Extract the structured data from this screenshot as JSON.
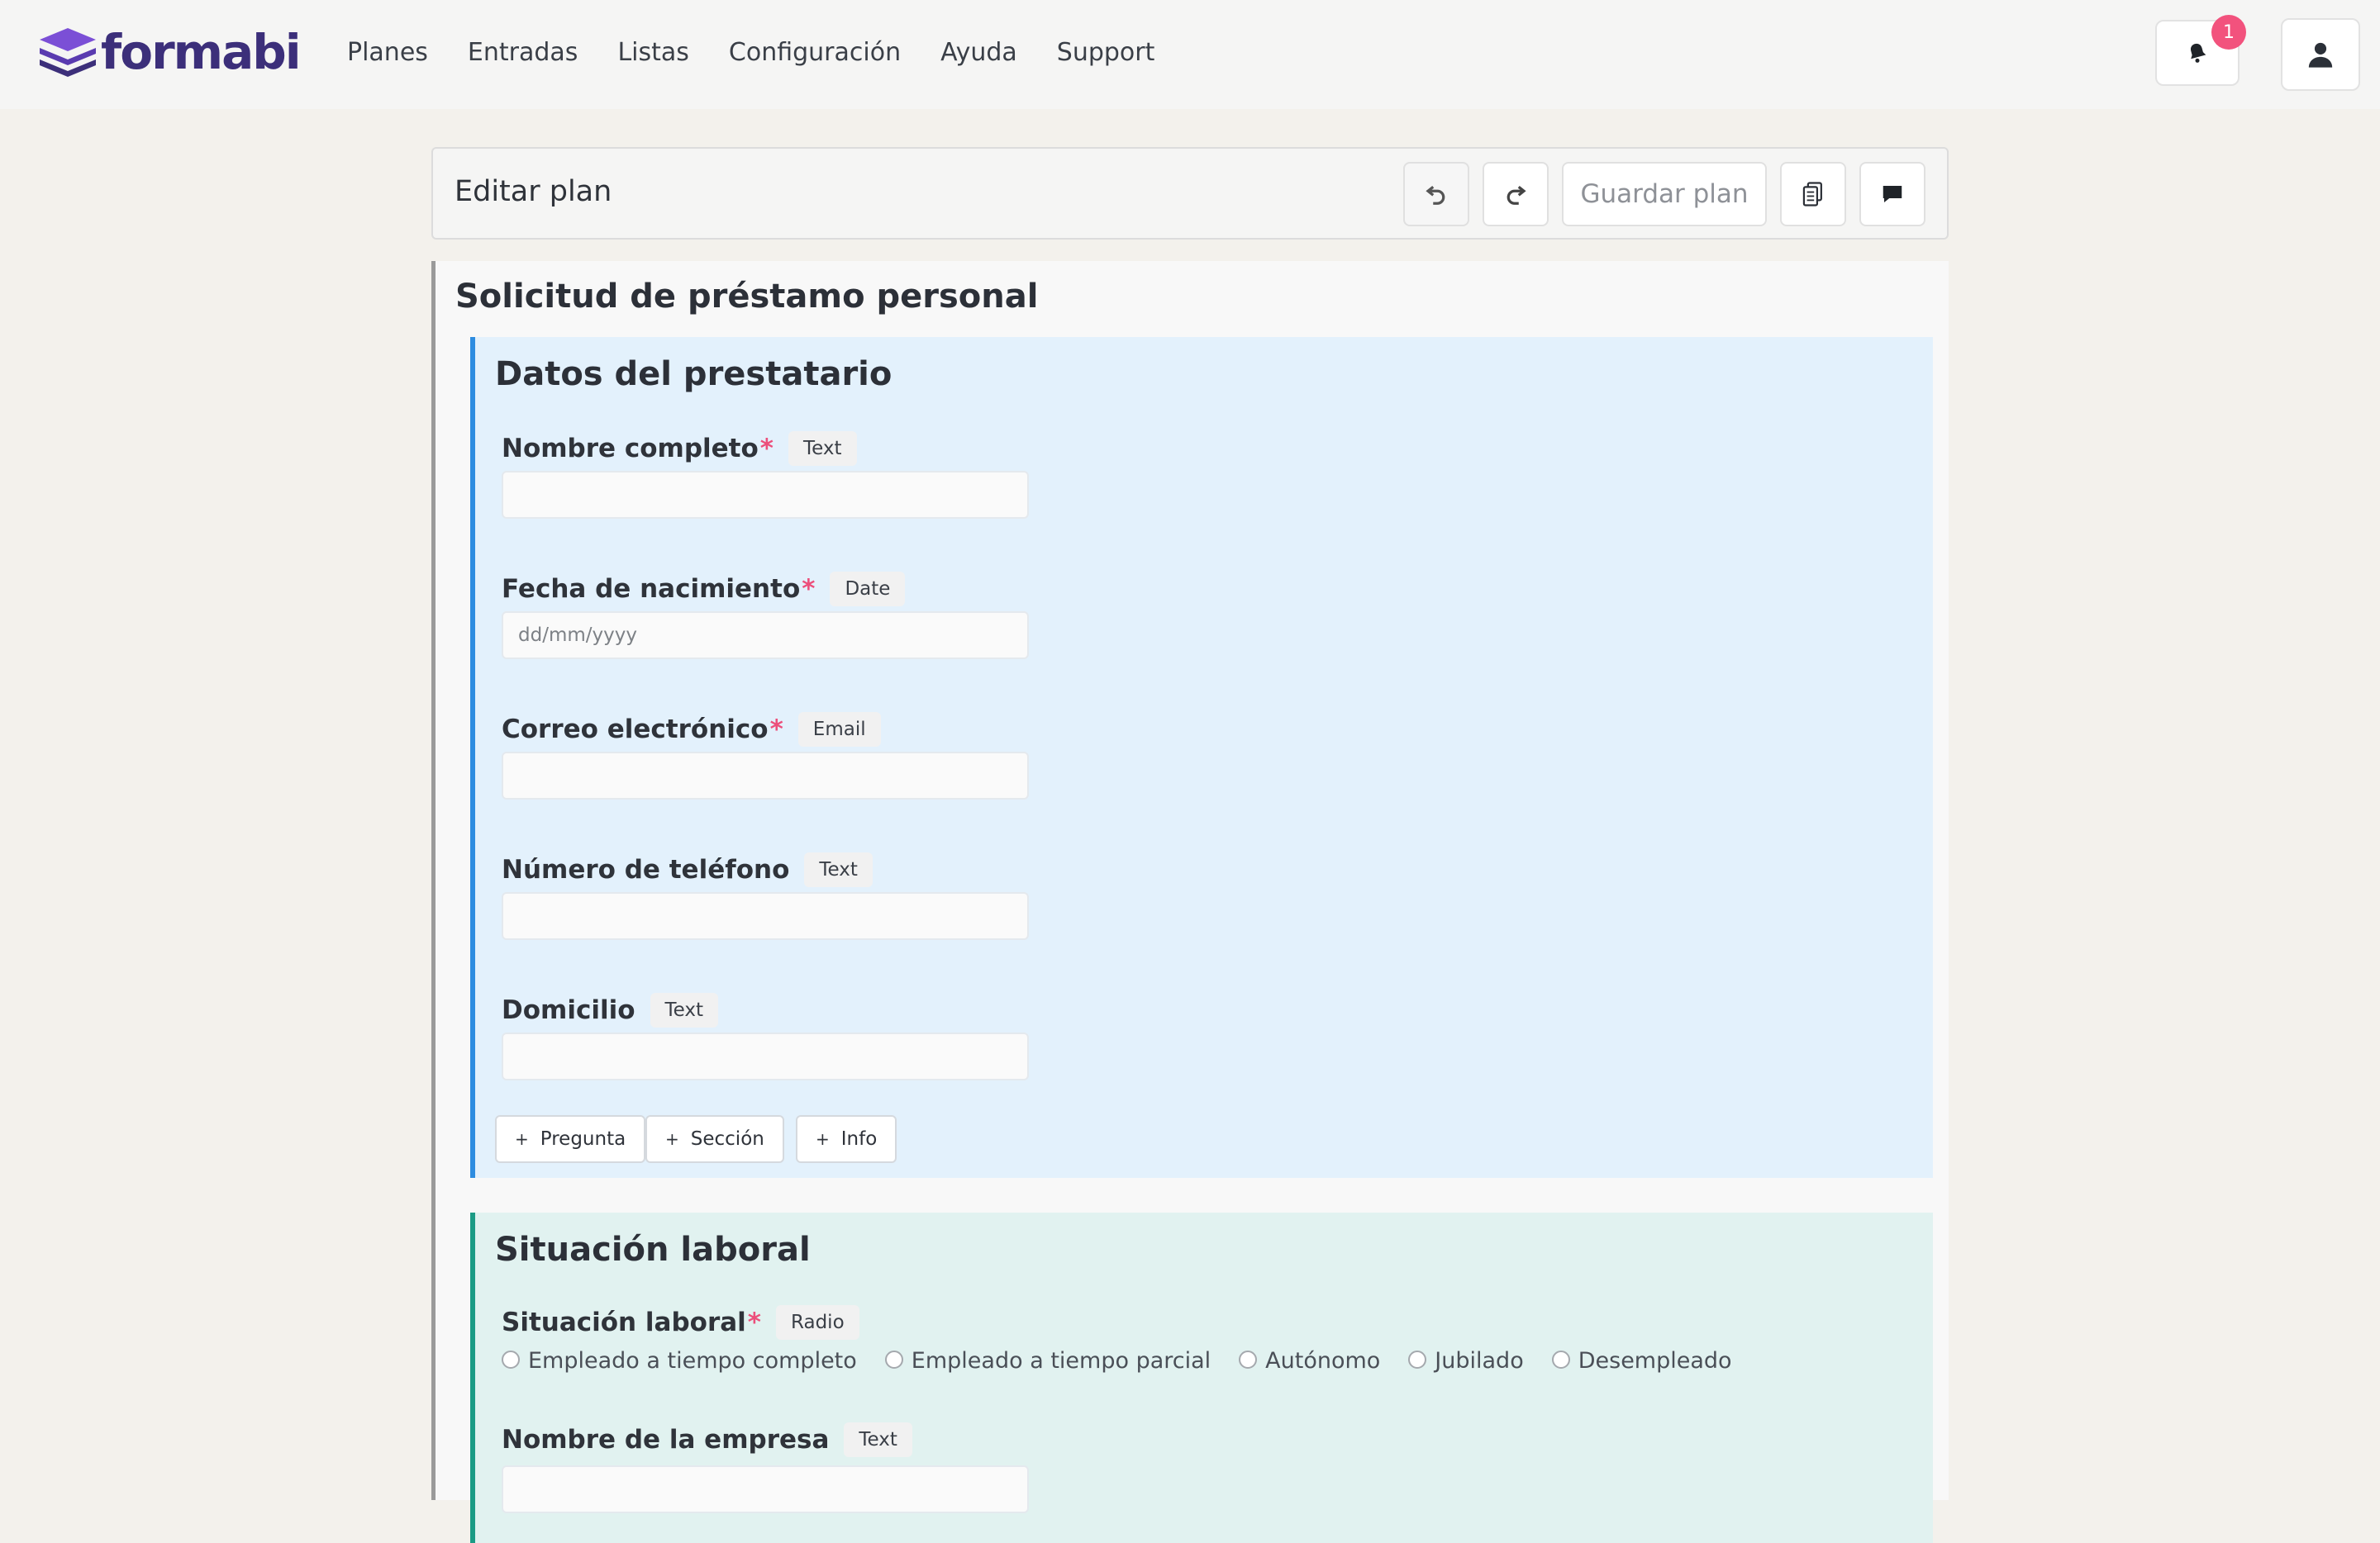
{
  "app": {
    "logo_text": "formabi"
  },
  "nav": {
    "links": [
      "Planes",
      "Entradas",
      "Listas",
      "Configuración",
      "Ayuda",
      "Support"
    ],
    "notification_count": "1"
  },
  "toolbar": {
    "title": "Editar plan",
    "save_label": "Guardar plan"
  },
  "form": {
    "title": "Solicitud de préstamo personal",
    "sections": [
      {
        "title": "Datos del prestatario",
        "questions": [
          {
            "label": "Nombre completo",
            "required": true,
            "type": "Text",
            "value": ""
          },
          {
            "label": "Fecha de nacimiento",
            "required": true,
            "type": "Date",
            "placeholder": "dd/mm/yyyy"
          },
          {
            "label": "Correo electrónico",
            "required": true,
            "type": "Email",
            "value": ""
          },
          {
            "label": "Número de teléfono",
            "required": false,
            "type": "Text",
            "value": ""
          },
          {
            "label": "Domicilio",
            "required": false,
            "type": "Text",
            "value": ""
          }
        ],
        "add_buttons": [
          "Pregunta",
          "Sección",
          "Info"
        ]
      },
      {
        "title": "Situación laboral",
        "questions": [
          {
            "label": "Situación laboral",
            "required": true,
            "type": "Radio",
            "options": [
              "Empleado a tiempo completo",
              "Empleado a tiempo parcial",
              "Autónomo",
              "Jubilado",
              "Desempleado"
            ]
          },
          {
            "label": "Nombre de la empresa",
            "required": false,
            "type": "Text",
            "value": ""
          }
        ]
      }
    ]
  },
  "required_marker": "*",
  "add_symbol": "+",
  "colors": {
    "brand": "#3c2f7a",
    "section_personal_accent": "#2d8ce0",
    "section_employment_accent": "#1b9b85",
    "required": "#ec4f7b",
    "notification_badge": "#f2527d"
  },
  "icons": [
    "logo-layers-icon",
    "bell-icon",
    "user-icon",
    "undo-icon",
    "redo-icon",
    "copy-document-icon",
    "comment-icon"
  ]
}
